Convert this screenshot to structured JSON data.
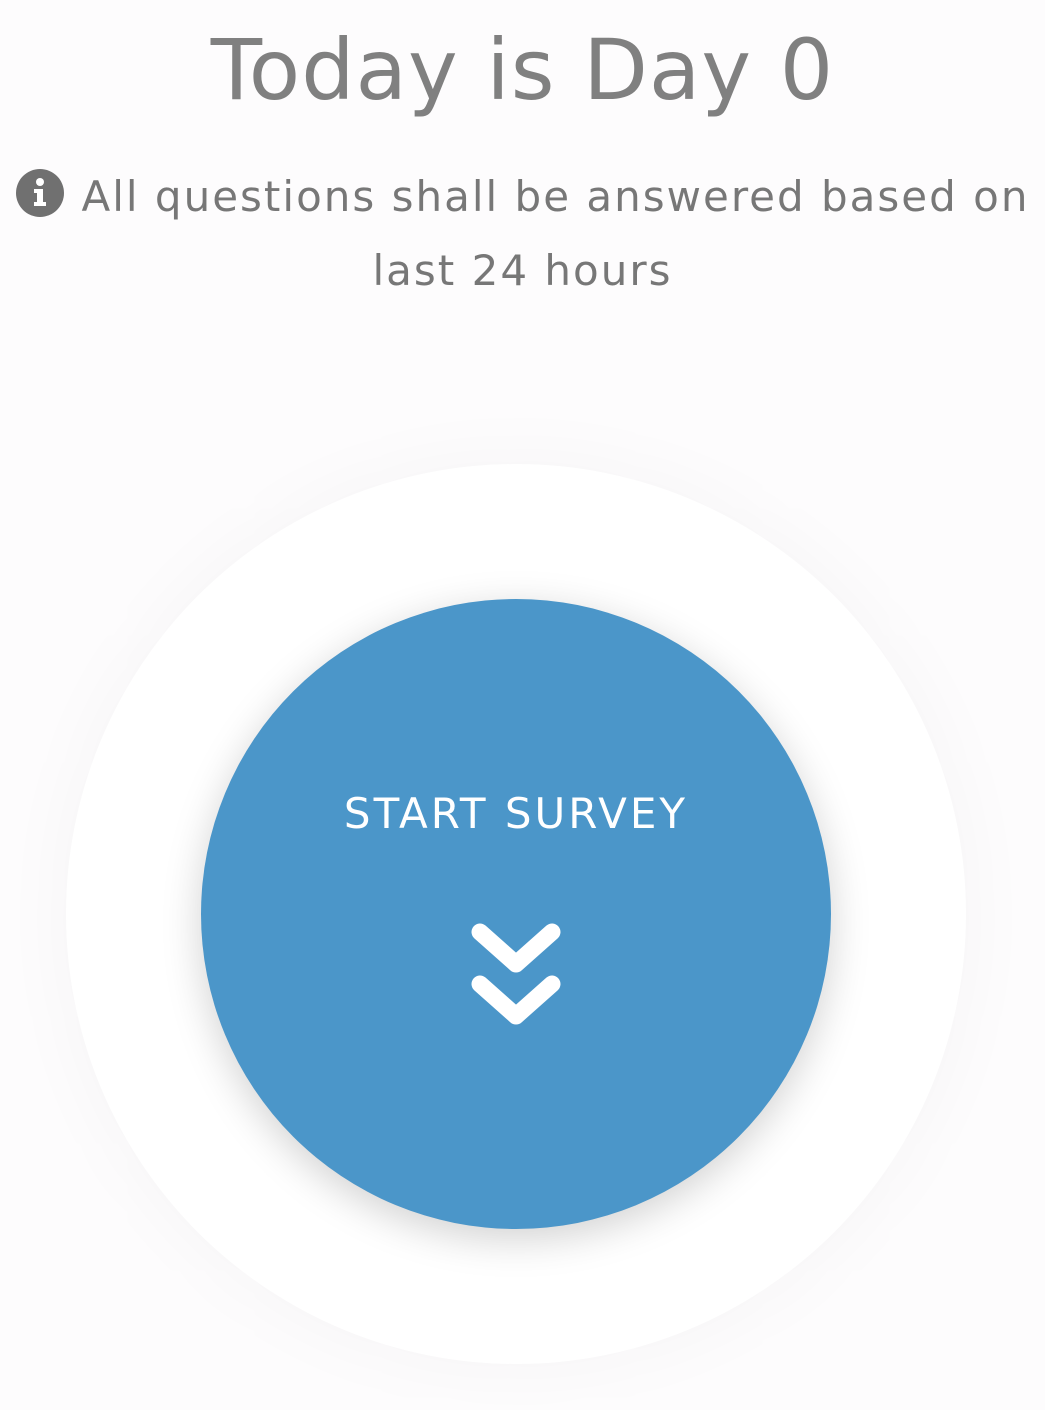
{
  "header": {
    "title": "Today is Day 0"
  },
  "notice": {
    "icon": "info-icon",
    "text": "All questions shall be answered based on last 24 hours"
  },
  "survey_button": {
    "label": "START SURVEY",
    "icon": "double-chevron-down-icon",
    "color": "#4b96c9"
  }
}
